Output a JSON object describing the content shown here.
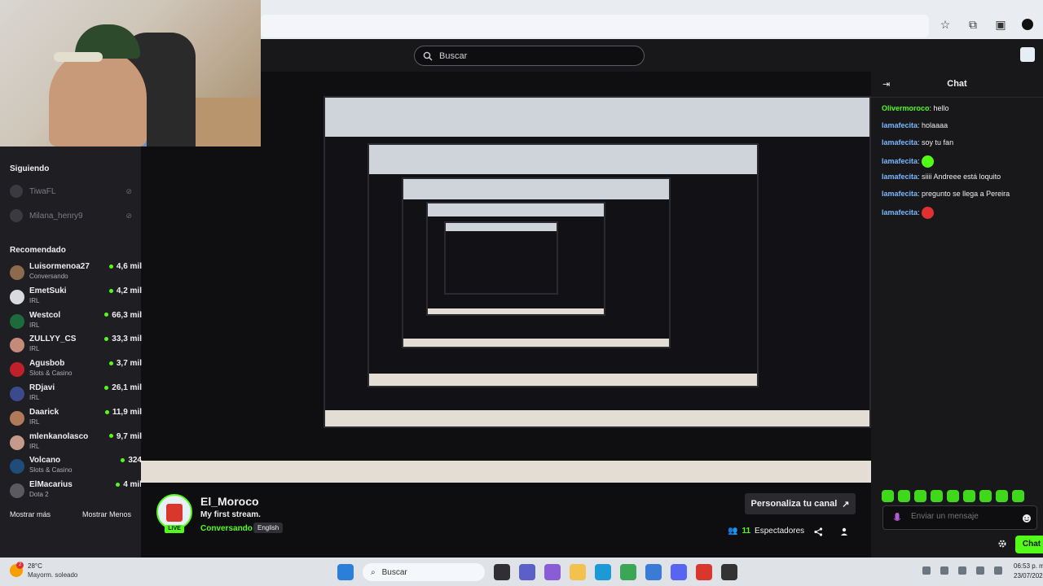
{
  "search": {
    "placeholder": "Buscar"
  },
  "sidebar": {
    "following_title": "Siguiendo",
    "following": [
      {
        "name": "TiwaFL"
      },
      {
        "name": "Milana_henry9"
      }
    ],
    "recommended_title": "Recomendado",
    "recommended": [
      {
        "name": "Luisormenoa27",
        "category": "Conversando",
        "viewers": "4,6 mil",
        "color": "#8b6a4e"
      },
      {
        "name": "EmetSuki",
        "category": "IRL",
        "viewers": "4,2 mil",
        "color": "#d9d9e0"
      },
      {
        "name": "Westcol",
        "category": "IRL",
        "viewers": "66,3 mil",
        "color": "#1d6b3a"
      },
      {
        "name": "ZULLYY_CS",
        "category": "IRL",
        "viewers": "33,3 mil",
        "color": "#c48a7a"
      },
      {
        "name": "Agusbob",
        "category": "Slots & Casino",
        "viewers": "3,7 mil",
        "color": "#c0202a"
      },
      {
        "name": "RDjavi",
        "category": "IRL",
        "viewers": "26,1 mil",
        "color": "#3b4a8c"
      },
      {
        "name": "Daarick",
        "category": "IRL",
        "viewers": "11,9 mil",
        "color": "#b07a5a"
      },
      {
        "name": "mlenkanolasco",
        "category": "IRL",
        "viewers": "9,7 mil",
        "color": "#c69a8a"
      },
      {
        "name": "Volcano",
        "category": "Slots & Casino",
        "viewers": "324",
        "color": "#1f4d7a"
      },
      {
        "name": "ElMacarius",
        "category": "Dota 2",
        "viewers": "4 mil",
        "color": "#5a5a60"
      }
    ],
    "show_more": "Mostrar más",
    "show_less": "Mostrar Menos"
  },
  "chat": {
    "title": "Chat",
    "messages": [
      {
        "user": "Olivermoroco",
        "text": "hello",
        "color": "#53fc18"
      },
      {
        "user": "lamafecita",
        "text": "holaaaa",
        "color": "#7ab8ff"
      },
      {
        "user": "lamafecita",
        "text": "soy tu fan",
        "color": "#7ab8ff"
      },
      {
        "user": "lamafecita",
        "text": "",
        "emote": "green",
        "color": "#7ab8ff"
      },
      {
        "user": "lamafecita",
        "text": "siiii Andreee está loquito",
        "color": "#7ab8ff"
      },
      {
        "user": "lamafecita",
        "text": "pregunto se llega a Pereira",
        "color": "#7ab8ff"
      },
      {
        "user": "lamafecita",
        "text": "",
        "emote": "red",
        "color": "#7ab8ff"
      }
    ],
    "input_placeholder": "Enviar un mensaje",
    "send_label": "Chat"
  },
  "stream_info": {
    "channel": "El_Moroco",
    "title": "My first stream.",
    "category": "Conversando",
    "tag": "English",
    "live": "LIVE",
    "personalize": "Personaliza tu canal",
    "viewer_count": "11",
    "viewer_label": "Espectadores"
  },
  "taskbar": {
    "temp": "28°C",
    "weather": "Mayorm. soleado",
    "badge": "2",
    "search": "Buscar",
    "time": "06:53 p. m.",
    "date": "23/07/2024"
  },
  "colors": {
    "accent": "#53fc18",
    "bg": "#0e0e10",
    "panel": "#18181b"
  }
}
